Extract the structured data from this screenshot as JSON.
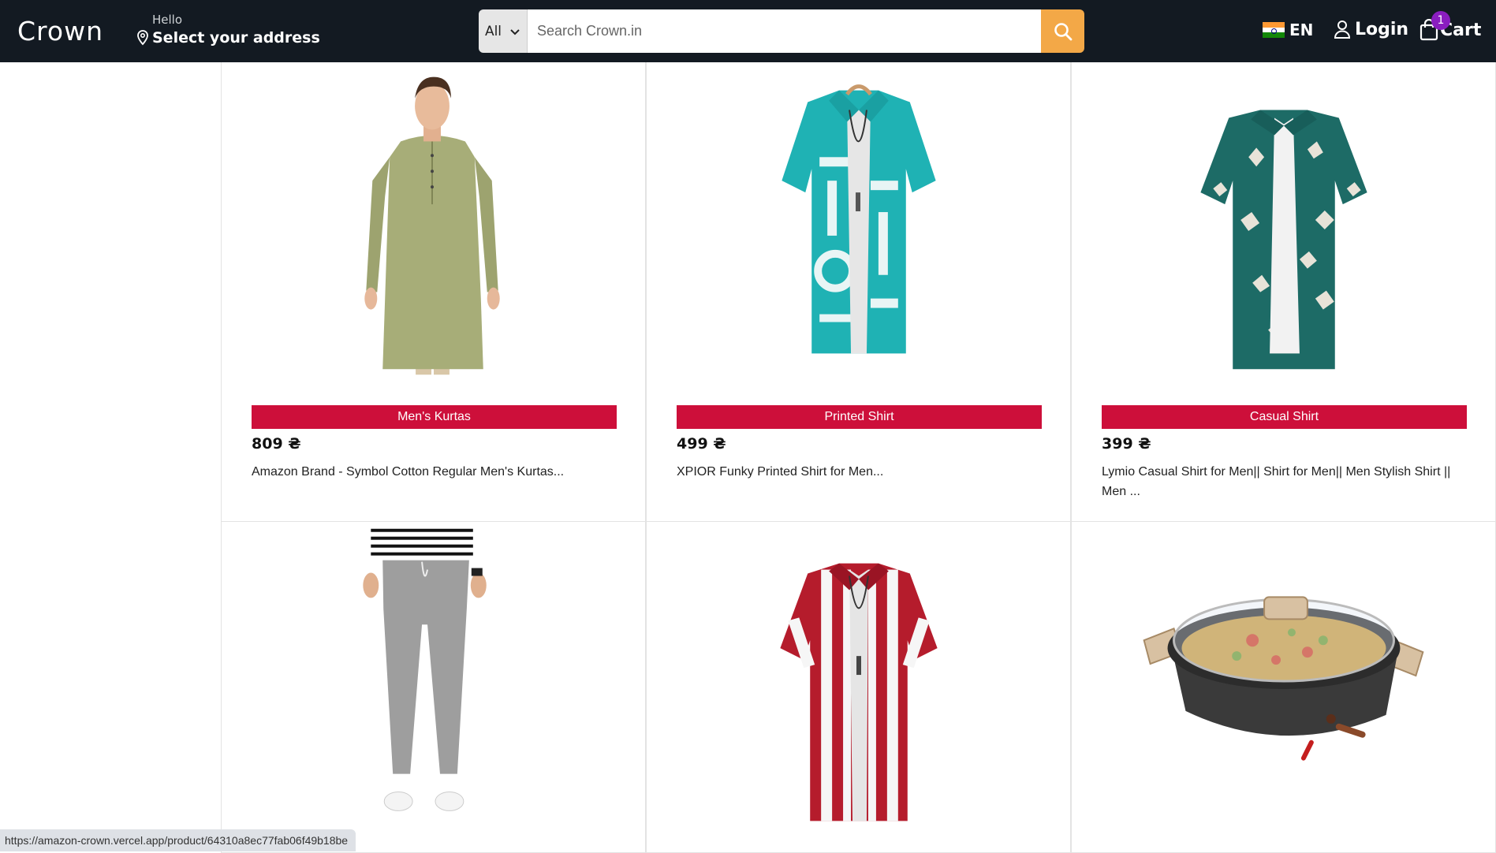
{
  "header": {
    "logo": "Crown",
    "hello": "Hello",
    "address": "Select your address",
    "search_category": "All",
    "search_placeholder": "Search Crown.in",
    "language": "EN",
    "login": "Login",
    "cart": "Cart",
    "cart_count": "1"
  },
  "products": [
    {
      "category": "Men's Kurtas",
      "price": "809 ₴",
      "title": "Amazon Brand - Symbol Cotton Regular Men's Kurtas...",
      "image_icon": "kurta-image"
    },
    {
      "category": "Printed Shirt",
      "price": "499 ₴",
      "title": "XPIOR Funky Printed Shirt for Men...",
      "image_icon": "printed-shirt-image"
    },
    {
      "category": "Casual Shirt",
      "price": "399 ₴",
      "title": "Lymio Casual Shirt for Men|| Shirt for Men|| Men Stylish Shirt || Men ...",
      "image_icon": "casual-shirt-image"
    },
    {
      "image_icon": "pants-image"
    },
    {
      "image_icon": "striped-shirt-image"
    },
    {
      "image_icon": "cookware-pan-image"
    }
  ],
  "status_url": "https://amazon-crown.vercel.app/product/64310a8ec77fab06f49b18be",
  "colors": {
    "header_bg": "#131a22",
    "search_button": "#f3a847",
    "category_badge": "#cd0f3a",
    "cart_badge": "#8a1dbf"
  }
}
